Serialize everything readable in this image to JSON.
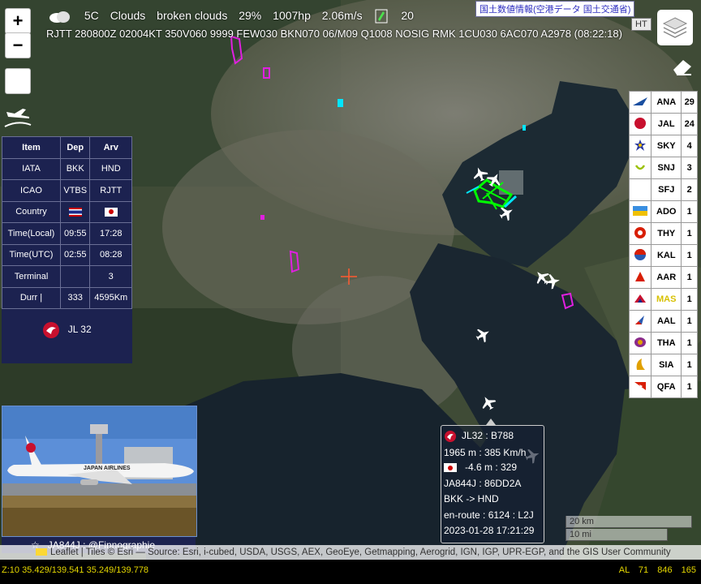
{
  "map_controls": {
    "zoom_in": "+",
    "zoom_out": "−"
  },
  "weather": {
    "temp": "5C",
    "condition": "Clouds",
    "description": "broken clouds",
    "humidity": "29%",
    "pressure": "1007hp",
    "wind": "2.06m/s",
    "count": "20"
  },
  "metar": "RJTT 280800Z 02004KT 350V060 9999 FEW030 BKN070 06/M09 Q1008 NOSIG RMK 1CU030 6AC070 A2978 (08:22:18)",
  "gsi_label": "国土数値情報(空港データ 国土交通省)",
  "ht_label": "HT",
  "flight_info": {
    "headers": [
      "Item",
      "Dep",
      "Arv"
    ],
    "rows": [
      {
        "item": "IATA",
        "dep": "BKK",
        "arv": "HND"
      },
      {
        "item": "ICAO",
        "dep": "VTBS",
        "arv": "RJTT"
      },
      {
        "item": "Country",
        "dep": "",
        "arv": ""
      },
      {
        "item": "Time(Local)",
        "dep": "09:55",
        "arv": "17:28"
      },
      {
        "item": "Time(UTC)",
        "dep": "02:55",
        "arv": "08:28"
      },
      {
        "item": "Terminal",
        "dep": "",
        "arv": "3"
      },
      {
        "item": "Durr |",
        "dep": "333",
        "arv": "4595Km"
      }
    ],
    "flight": "JL 32"
  },
  "airlines": [
    {
      "code": "ANA",
      "count": "29"
    },
    {
      "code": "JAL",
      "count": "24"
    },
    {
      "code": "SKY",
      "count": "4"
    },
    {
      "code": "SNJ",
      "count": "3"
    },
    {
      "code": "SFJ",
      "count": "2"
    },
    {
      "code": "ADO",
      "count": "1"
    },
    {
      "code": "THY",
      "count": "1"
    },
    {
      "code": "KAL",
      "count": "1"
    },
    {
      "code": "AAR",
      "count": "1"
    },
    {
      "code": "MAS",
      "count": "1"
    },
    {
      "code": "AAL",
      "count": "1"
    },
    {
      "code": "THA",
      "count": "1"
    },
    {
      "code": "SIA",
      "count": "1"
    },
    {
      "code": "QFA",
      "count": "1"
    }
  ],
  "popup": {
    "line1": "JL32 : B788",
    "line2": "1965 m : 385 Km/h",
    "line3": "-4.6 m : 329",
    "line4": "JA844J : 86DD2A",
    "line5": "BKK -> HND",
    "line6": "en-route : 6124 : L2J",
    "line7": "2023-01-28 17:21:29"
  },
  "photo_caption": "JA844J : @Finnographie",
  "photo_livery": "JAPAN AIRLINES",
  "scale": {
    "km": "20 km",
    "mi": "10 mi"
  },
  "attribution": "Leaflet | Tiles © Esri — Source: Esri, i-cubed, USDA, USGS, AEX, GeoEye, Getmapping, Aerogrid, IGN, IGP, UPR-EGP, and the GIS User Community",
  "status": {
    "zoom_coords": "Z:10 35.429/139.541   35.249/139.778",
    "al": "AL",
    "v1": "71",
    "v2": "846",
    "v3": "165"
  },
  "colors": {
    "panel": "#1c2250",
    "highlight": "#d7c000",
    "track": "#00ff00"
  }
}
